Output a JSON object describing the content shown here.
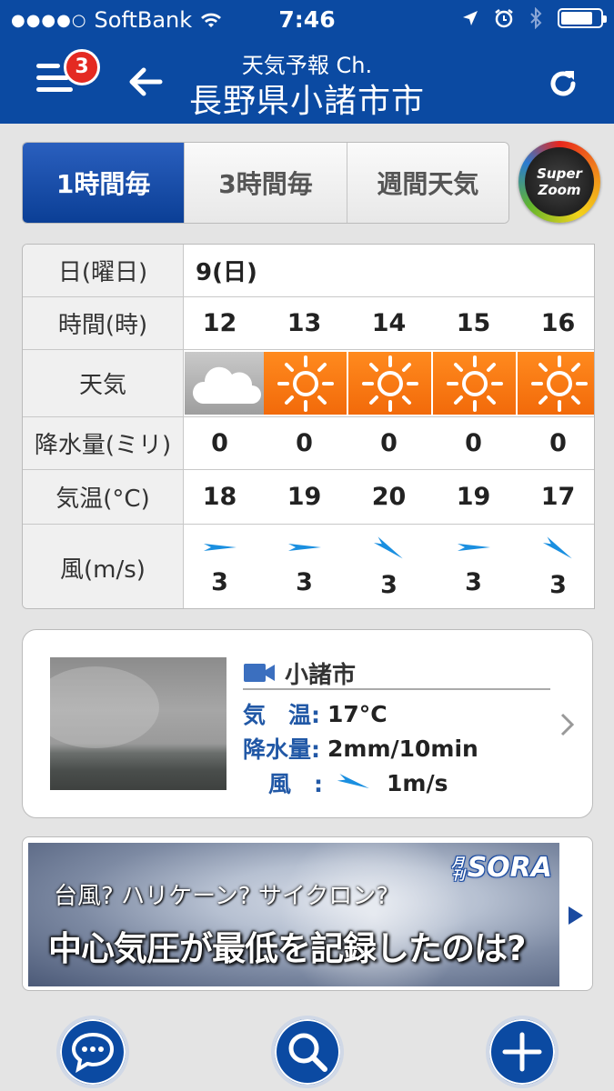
{
  "status_bar": {
    "carrier": "SoftBank",
    "time": "7:46",
    "signal_dots": "●●●●○"
  },
  "nav": {
    "subtitle": "天気予報 Ch.",
    "title": "長野県小諸市市",
    "notification_count": "3"
  },
  "tabs": [
    {
      "label": "1時間毎",
      "active": true
    },
    {
      "label": "3時間毎",
      "active": false
    },
    {
      "label": "週間天気",
      "active": false
    }
  ],
  "super_zoom": {
    "line1": "Super",
    "line2": "Zoom"
  },
  "forecast": {
    "labels": {
      "date": "日(曜日)",
      "hour": "時間(時)",
      "weather": "天気",
      "precip": "降水量(ミリ)",
      "temp": "気温(°C)",
      "wind": "風(m/s)"
    },
    "date_value": "9(日)",
    "hours": [
      "12",
      "13",
      "14",
      "15",
      "16"
    ],
    "weather_icons": [
      "cloud-icon",
      "sun-icon",
      "sun-icon",
      "sun-icon",
      "sun-icon"
    ],
    "precip": [
      "0",
      "0",
      "0",
      "0",
      "0"
    ],
    "temps": [
      "18",
      "19",
      "20",
      "19",
      "17"
    ],
    "wind_speeds": [
      "3",
      "3",
      "3",
      "3",
      "3"
    ],
    "wind_dirs": [
      "east",
      "east",
      "southeast",
      "east",
      "southeast"
    ]
  },
  "live_camera": {
    "location": "小諸市",
    "temp_label": "気　温:",
    "temp_value": "17°C",
    "precip_label": "降水量:",
    "precip_value": "2mm/10min",
    "wind_label": "風　:",
    "wind_value": "1m/s"
  },
  "banner": {
    "line1": "台風? ハリケーン? サイクロン?",
    "line2": "中心気圧が最低を記録したのは?",
    "brand_small": "月刊",
    "brand": "SORA"
  },
  "colors": {
    "primary": "#0b4aa2",
    "sun": "#f5801a",
    "badge": "#e42a22"
  }
}
